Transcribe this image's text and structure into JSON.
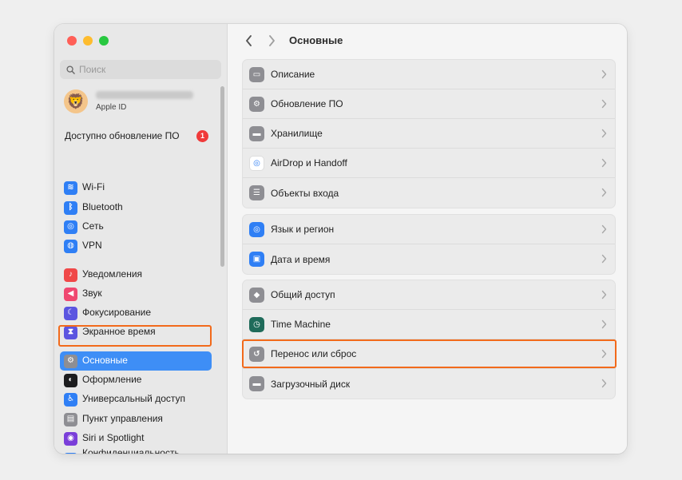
{
  "window": {
    "traffic_lights": [
      {
        "name": "close-button",
        "color": "#ff5f57"
      },
      {
        "name": "minimize-button",
        "color": "#febc2e"
      },
      {
        "name": "zoom-button",
        "color": "#28c840"
      }
    ]
  },
  "sidebar": {
    "search_placeholder": "Поиск",
    "profile": {
      "subtitle": "Apple ID"
    },
    "update": {
      "label": "Доступно обновление ПО",
      "badge": "1"
    },
    "items": [
      {
        "label": "Wi-Fi",
        "icon": "wifi-icon",
        "color": "#2f7ff5",
        "glyph": "≋"
      },
      {
        "label": "Bluetooth",
        "icon": "bluetooth-icon",
        "color": "#2f7ff5",
        "glyph": "ᛒ"
      },
      {
        "label": "Сеть",
        "icon": "globe-icon",
        "color": "#2f7ff5",
        "glyph": "◎"
      },
      {
        "label": "VPN",
        "icon": "vpn-icon",
        "color": "#2f7ff5",
        "glyph": "◍"
      },
      {
        "label": "Уведомления",
        "icon": "bell-icon",
        "color": "#f04848",
        "glyph": "♪"
      },
      {
        "label": "Звук",
        "icon": "speaker-icon",
        "color": "#f04870",
        "glyph": "◀"
      },
      {
        "label": "Фокусирование",
        "icon": "moon-icon",
        "color": "#5b55e0",
        "glyph": "☾"
      },
      {
        "label": "Экранное время",
        "icon": "hourglass-icon",
        "color": "#5b55e0",
        "glyph": "⧗"
      },
      {
        "label": "Основные",
        "icon": "gear-icon",
        "color": "#8e8e93",
        "glyph": "⚙"
      },
      {
        "label": "Оформление",
        "icon": "appearance-icon",
        "color": "#1c1c1e",
        "glyph": "◐"
      },
      {
        "label": "Универсальный доступ",
        "icon": "accessibility-icon",
        "color": "#2f7ff5",
        "glyph": "♿"
      },
      {
        "label": "Пункт управления",
        "icon": "control-center-icon",
        "color": "#8e8e93",
        "glyph": "▤"
      },
      {
        "label": "Siri и Spotlight",
        "icon": "siri-icon",
        "color": "#7a3ed9",
        "glyph": "◉"
      },
      {
        "label": "Конфиденциальность\nи безопасность",
        "icon": "hand-icon",
        "color": "#2f7ff5",
        "glyph": "✋"
      }
    ]
  },
  "header": {
    "title": "Основные"
  },
  "groups": [
    [
      {
        "label": "Описание",
        "icon": "laptop-icon",
        "color": "#8e8e93",
        "glyph": "▭"
      },
      {
        "label": "Обновление ПО",
        "icon": "software-update-icon",
        "color": "#8e8e93",
        "glyph": "⚙"
      },
      {
        "label": "Хранилище",
        "icon": "storage-icon",
        "color": "#8e8e93",
        "glyph": "▬"
      },
      {
        "label": "AirDrop и Handoff",
        "icon": "airdrop-icon",
        "color": "#ffffff",
        "glyph": "◎"
      },
      {
        "label": "Объекты входа",
        "icon": "login-items-icon",
        "color": "#8e8e93",
        "glyph": "☰"
      }
    ],
    [
      {
        "label": "Язык и регион",
        "icon": "language-globe-icon",
        "color": "#2f7ff5",
        "glyph": "◎"
      },
      {
        "label": "Дата и время",
        "icon": "calendar-clock-icon",
        "color": "#2f7ff5",
        "glyph": "▣"
      }
    ],
    [
      {
        "label": "Общий доступ",
        "icon": "sharing-icon",
        "color": "#8e8e93",
        "glyph": "◆"
      },
      {
        "label": "Time Machine",
        "icon": "time-machine-icon",
        "color": "#1f6b5a",
        "glyph": "◷"
      },
      {
        "label": "Перенос или сброс",
        "icon": "transfer-reset-icon",
        "color": "#8e8e93",
        "glyph": "↺"
      },
      {
        "label": "Загрузочный диск",
        "icon": "startup-disk-icon",
        "color": "#8e8e93",
        "glyph": "▬"
      }
    ]
  ]
}
